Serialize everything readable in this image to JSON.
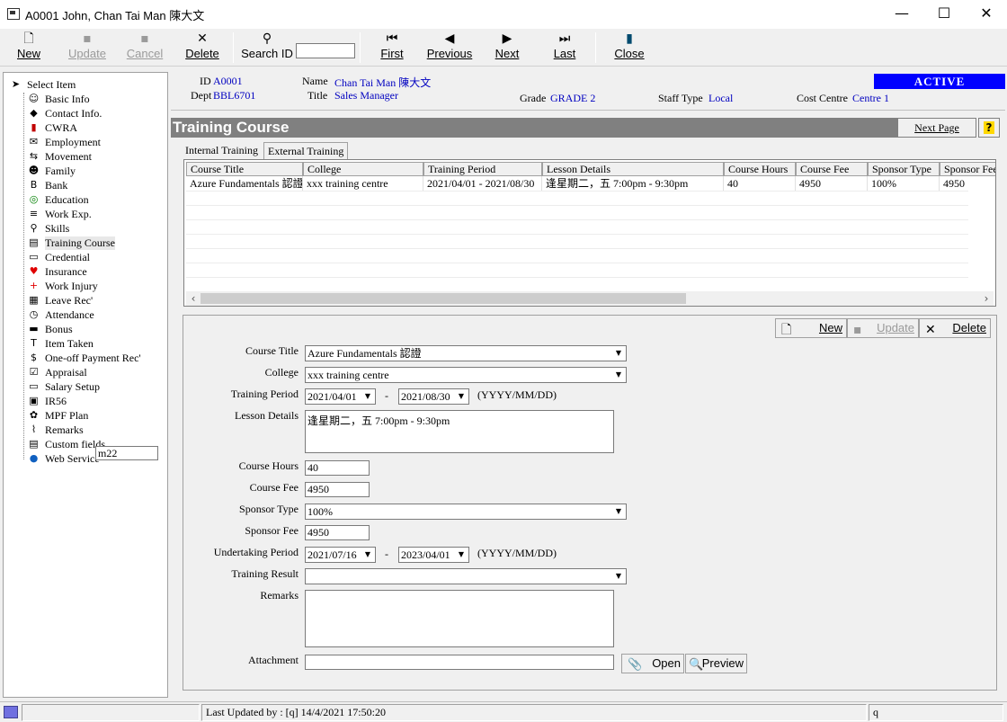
{
  "window": {
    "title": "A0001 John, Chan Tai Man 陳大文",
    "minimize_icon": "minimize-icon",
    "maximize_icon": "maximize-icon",
    "close_icon": "close-icon"
  },
  "toolbar": {
    "new": "New",
    "update": "Update",
    "cancel": "Cancel",
    "delete": "Delete",
    "search_id": "Search ID",
    "search_value": "",
    "first": "First",
    "previous": "Previous",
    "next": "Next",
    "last": "Last",
    "close": "Close"
  },
  "tree": {
    "root": "Select Item",
    "items": [
      {
        "label": "Basic Info",
        "icon": "person-icon"
      },
      {
        "label": "Contact Info.",
        "icon": "contact-icon"
      },
      {
        "label": "CWRA",
        "icon": "book-icon"
      },
      {
        "label": "Employment",
        "icon": "envelope-icon"
      },
      {
        "label": "Movement",
        "icon": "movement-icon"
      },
      {
        "label": "Family",
        "icon": "family-icon"
      },
      {
        "label": "Bank",
        "icon": "bank-icon"
      },
      {
        "label": "Education",
        "icon": "globe-icon"
      },
      {
        "label": "Work Exp.",
        "icon": "document-icon"
      },
      {
        "label": "Skills",
        "icon": "magnifier-icon"
      },
      {
        "label": "Training Course",
        "icon": "training-icon"
      },
      {
        "label": "Credential",
        "icon": "card-icon"
      },
      {
        "label": "Insurance",
        "icon": "heart-icon"
      },
      {
        "label": "Work Injury",
        "icon": "cross-icon"
      },
      {
        "label": "Leave Rec'",
        "icon": "calendar-icon"
      },
      {
        "label": "Attendance",
        "icon": "clock-icon"
      },
      {
        "label": "Bonus",
        "icon": "bonus-icon"
      },
      {
        "label": "Item Taken",
        "icon": "item-icon"
      },
      {
        "label": "One-off Payment Rec'",
        "icon": "dollar-icon"
      },
      {
        "label": "Appraisal",
        "icon": "checklist-icon"
      },
      {
        "label": "Salary Setup",
        "icon": "salary-icon"
      },
      {
        "label": "IR56",
        "icon": "form-icon"
      },
      {
        "label": "MPF Plan",
        "icon": "plan-icon"
      },
      {
        "label": "Remarks",
        "icon": "paperclip-icon"
      },
      {
        "label": "Custom fields",
        "icon": "custom-icon"
      },
      {
        "label": "Web Service",
        "icon": "web-icon"
      }
    ],
    "edit_value": "m22"
  },
  "header": {
    "id_label": "ID",
    "id_value": "A0001",
    "dept_label": "Dept",
    "dept_value": "BBL6701",
    "name_label": "Name",
    "name_value": "Chan Tai Man 陳大文",
    "title_label": "Title",
    "title_value": "Sales Manager",
    "grade_label": "Grade",
    "grade_value": "GRADE 2",
    "staff_type_label": "Staff Type",
    "staff_type_value": "Local",
    "cost_centre_label": "Cost Centre",
    "cost_centre_value": "Centre 1",
    "status": "ACTIVE",
    "status_color": "#0000ff",
    "value_color": "#0000c0"
  },
  "section": {
    "title": "Training Course",
    "next_page": "Next Page",
    "help": "?"
  },
  "tabs": [
    {
      "label": "Internal Training",
      "active": false
    },
    {
      "label": "External Training",
      "active": true
    }
  ],
  "grid": {
    "columns": [
      "Course Title",
      "College",
      "Training Period",
      "Lesson Details",
      "Course Hours",
      "Course Fee",
      "Sponsor Type",
      "Sponsor Fee"
    ],
    "rows": [
      [
        "Azure Fundamentals 認證",
        "xxx training centre",
        "2021/04/01 - 2021/08/30",
        "逢星期二，五 7:00pm - 9:30pm",
        "40",
        "4950",
        "100%",
        "4950"
      ]
    ]
  },
  "form_buttons": {
    "new": "New",
    "update": "Update",
    "delete": "Delete"
  },
  "form": {
    "course_title_label": "Course Title",
    "course_title": "Azure Fundamentals 認證",
    "college_label": "College",
    "college": "xxx training centre",
    "training_period_label": "Training Period",
    "training_from": "2021/04/01",
    "training_to": "2021/08/30",
    "date_format": "(YYYY/MM/DD)",
    "dash": "-",
    "lesson_details_label": "Lesson Details",
    "lesson_details": "逢星期二，五 7:00pm - 9:30pm",
    "course_hours_label": "Course Hours",
    "course_hours": "40",
    "course_fee_label": "Course Fee",
    "course_fee": "4950",
    "sponsor_type_label": "Sponsor Type",
    "sponsor_type": "100%",
    "sponsor_fee_label": "Sponsor Fee",
    "sponsor_fee": "4950",
    "undertaking_period_label": "Undertaking Period",
    "undertaking_from": "2021/07/16",
    "undertaking_to": "2023/04/01",
    "training_result_label": "Training Result",
    "training_result": "",
    "remarks_label": "Remarks",
    "remarks": "",
    "attachment_label": "Attachment",
    "attachment": "",
    "open": "Open",
    "preview": "Preview"
  },
  "status_bar": {
    "last_updated": "Last Updated by : [q]  14/4/2021 17:50:20",
    "user": "q"
  }
}
